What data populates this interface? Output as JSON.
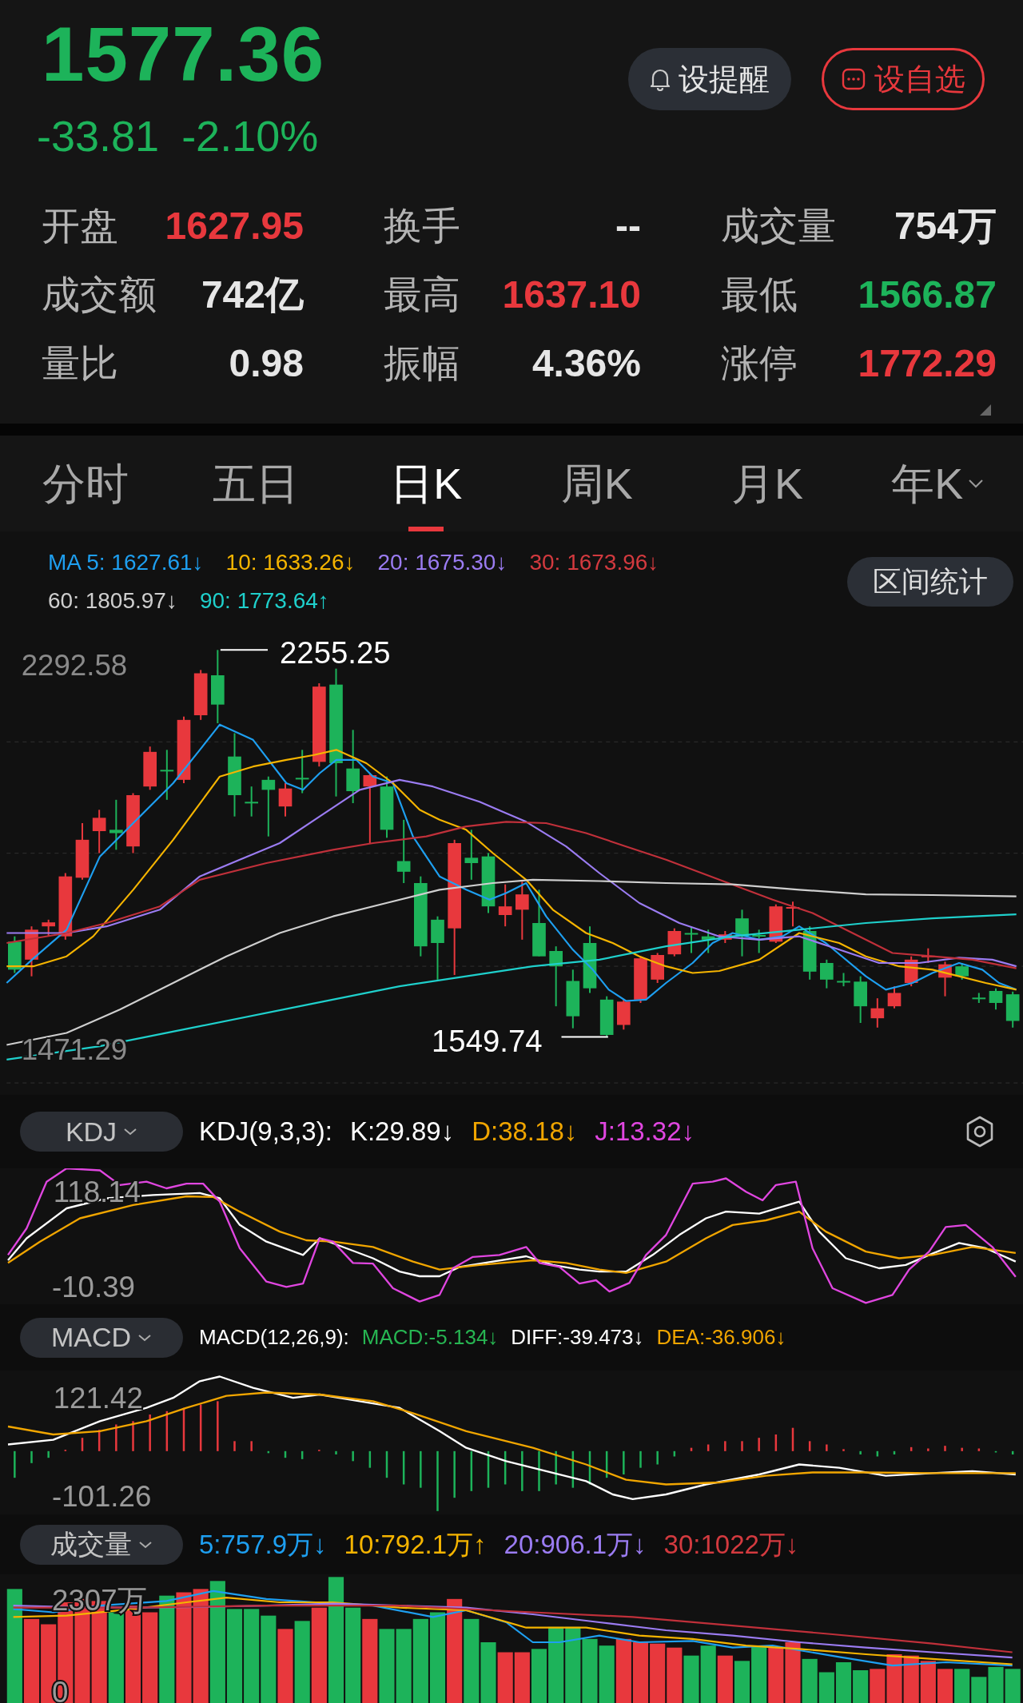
{
  "quote": {
    "price": "1577.36",
    "change": "-33.81",
    "change_pct": "-2.10%",
    "color": "#1db35a"
  },
  "buttons": [
    {
      "label": "设提醒",
      "kind": "alert"
    },
    {
      "label": "设自选",
      "kind": "watchlist"
    }
  ],
  "stats": [
    {
      "label": "开盘",
      "value": "1627.95",
      "color": "#e8383d"
    },
    {
      "label": "换手",
      "value": "--",
      "color": "#e6e6e6"
    },
    {
      "label": "成交量",
      "value": "754万",
      "color": "#e6e6e6"
    },
    {
      "label": "成交额",
      "value": "742亿",
      "color": "#e6e6e6"
    },
    {
      "label": "最高",
      "value": "1637.10",
      "color": "#e8383d"
    },
    {
      "label": "最低",
      "value": "1566.87",
      "color": "#1db35a"
    },
    {
      "label": "量比",
      "value": "0.98",
      "color": "#e6e6e6"
    },
    {
      "label": "振幅",
      "value": "4.36%",
      "color": "#e6e6e6"
    },
    {
      "label": "涨停",
      "value": "1772.29",
      "color": "#e8383d"
    }
  ],
  "period_tabs": [
    {
      "label": "分时",
      "selected": false,
      "dropdown": false
    },
    {
      "label": "五日",
      "selected": false,
      "dropdown": false
    },
    {
      "label": "日K",
      "selected": true,
      "dropdown": false
    },
    {
      "label": "周K",
      "selected": false,
      "dropdown": false
    },
    {
      "label": "月K",
      "selected": false,
      "dropdown": false
    },
    {
      "label": "年K",
      "selected": false,
      "dropdown": true
    }
  ],
  "ma_legend": [
    {
      "text": "MA 5: 1627.61↓",
      "color": "#1e9ff0"
    },
    {
      "text": "10: 1633.26↓",
      "color": "#f5b400"
    },
    {
      "text": "20: 1675.30↓",
      "color": "#9b7cf2"
    },
    {
      "text": "30: 1673.96↓",
      "color": "#d33a3f"
    },
    {
      "text": "60: 1805.97↓",
      "color": "#cfcfcf"
    },
    {
      "text": "90: 1773.64↑",
      "color": "#1fd0cc"
    }
  ],
  "range_stats_button": "区间统计",
  "price_chart": {
    "axis_labels": [
      "2292.58",
      "1471.29"
    ],
    "high_marker": "2255.25",
    "low_marker": "1549.74"
  },
  "indicators": [
    {
      "kind": "kdj",
      "name": "KDJ",
      "title": "KDJ(9,3,3):",
      "axis_labels": [
        "118.14",
        "-10.39"
      ],
      "values": [
        {
          "text": "K:29.89↓",
          "color": "#ffffff"
        },
        {
          "text": "D:38.18↓",
          "color": "#f0a500"
        },
        {
          "text": "J:13.32↓",
          "color": "#e046e0"
        }
      ]
    },
    {
      "kind": "macd",
      "name": "MACD",
      "title": "MACD(12,26,9):",
      "axis_labels": [
        "121.42",
        "-101.26"
      ],
      "values": [
        {
          "text": "MACD:-5.134↓",
          "color": "#27b552"
        },
        {
          "text": "DIFF:-39.473↓",
          "color": "#ffffff"
        },
        {
          "text": "DEA:-36.906↓",
          "color": "#f0a500"
        }
      ]
    },
    {
      "kind": "volume",
      "name": "成交量",
      "axis_labels": [
        "2307万",
        "0"
      ],
      "values": [
        {
          "text": "5:757.9万↓",
          "color": "#1e9ff0"
        },
        {
          "text": "10:792.1万↑",
          "color": "#f5b400"
        },
        {
          "text": "20:906.1万↓",
          "color": "#9b7cf2"
        },
        {
          "text": "30:1022万↓",
          "color": "#d33a3f"
        }
      ]
    }
  ]
}
